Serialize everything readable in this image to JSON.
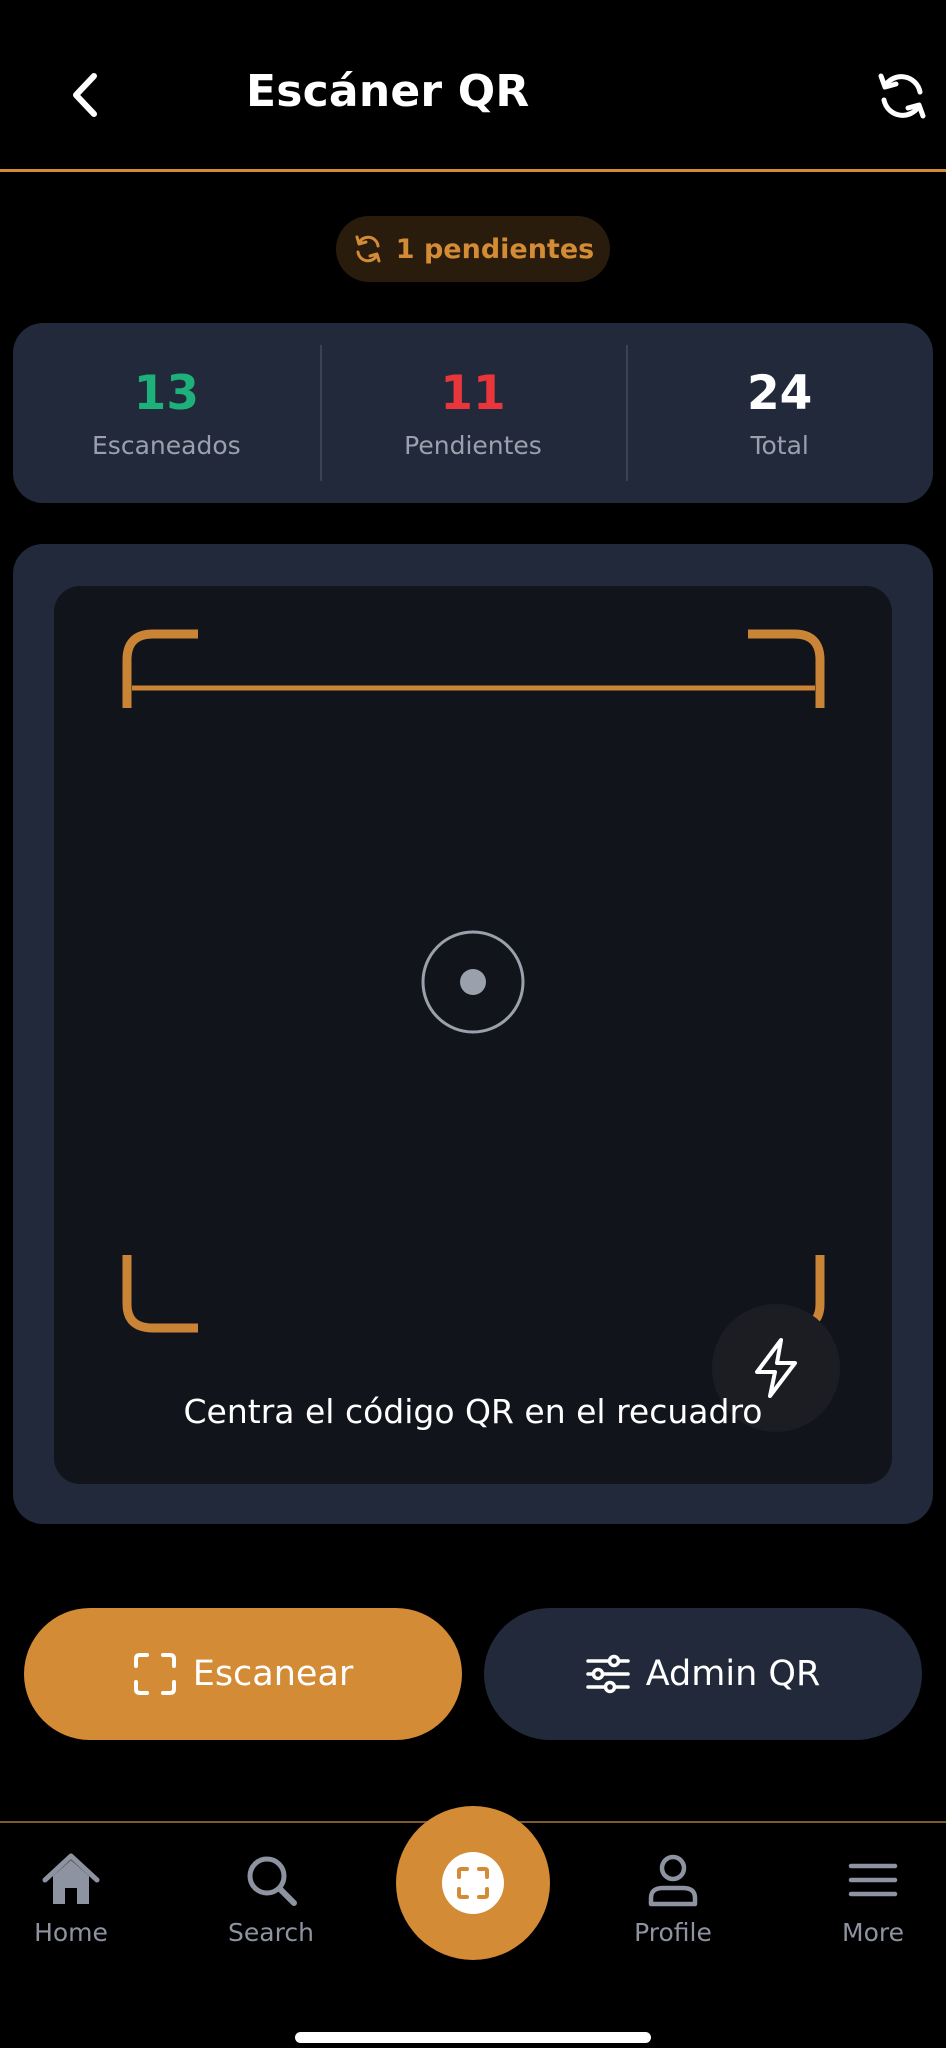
{
  "header": {
    "title": "Escáner QR",
    "back_icon": "chevron-left-icon",
    "refresh_icon": "refresh-icon"
  },
  "sync_pill": {
    "label": "1 pendientes",
    "icon": "sync-icon"
  },
  "stats": [
    {
      "value": "13",
      "label": "Escaneados",
      "color": "#1db07a"
    },
    {
      "value": "11",
      "label": "Pendientes",
      "color": "#e8363a"
    },
    {
      "value": "24",
      "label": "Total",
      "color": "#ffffff"
    }
  ],
  "scanner": {
    "hint": "Centra el código QR en el recuadro",
    "flash_icon": "flash-icon"
  },
  "actions": {
    "scan_label": "Escanear",
    "admin_label": "Admin QR"
  },
  "nav": {
    "home": "Home",
    "search": "Search",
    "profile": "Profile",
    "more": "More"
  },
  "colors": {
    "accent": "#d38b35",
    "card": "#22293a",
    "background": "#000000"
  }
}
